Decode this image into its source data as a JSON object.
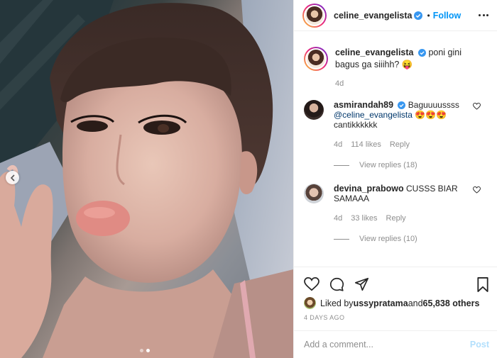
{
  "post": {
    "carousel": {
      "slides": 2,
      "active_slide": 2
    }
  },
  "header": {
    "username": "celine_evangelista",
    "separator": "•",
    "follow_label": "Follow"
  },
  "caption": {
    "username": "celine_evangelista",
    "text": "poni gini bagus ga siiihh? 😝",
    "time": "4d"
  },
  "comments": [
    {
      "username": "asmirandah89",
      "text_before": " Baguuuussss",
      "mention": "@celine_evangelista",
      "text_after": " 😍😍😍 cantikkkkkk",
      "time": "4d",
      "likes": "114 likes",
      "reply_label": "Reply",
      "view_replies": "View replies (18)"
    },
    {
      "username": "devina_prabowo",
      "text_before": " CUSSS BIAR SAMAAA",
      "mention": "",
      "text_after": "",
      "time": "4d",
      "likes": "33 likes",
      "reply_label": "Reply",
      "view_replies": "View replies (10)"
    }
  ],
  "likes": {
    "prefix": "Liked by ",
    "user": "ussypratama",
    "middle": " and ",
    "count": "65,838 others"
  },
  "date": "4 DAYS AGO",
  "add_comment": {
    "placeholder": "Add a comment...",
    "post_label": "Post"
  },
  "colors": {
    "accent": "#0095f6",
    "muted": "#8e8e8e",
    "text": "#262626",
    "post_disabled": "#b2dffc",
    "verified": "#3897f0"
  }
}
